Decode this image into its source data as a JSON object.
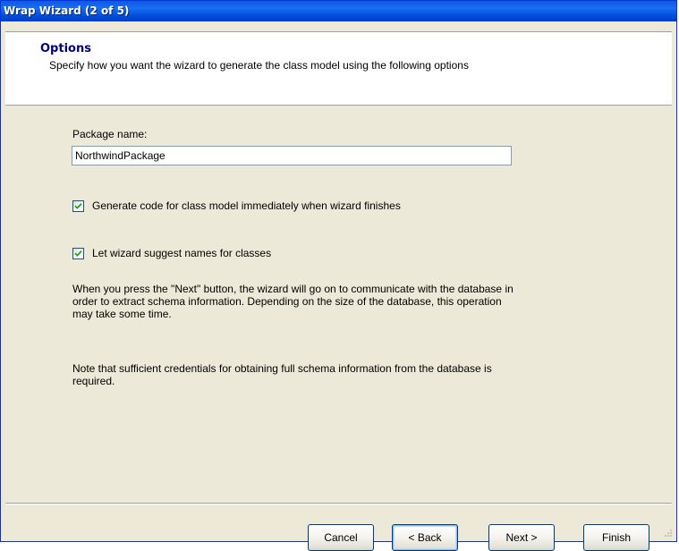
{
  "window": {
    "title": "Wrap Wizard (2 of 5)"
  },
  "header": {
    "title": "Options",
    "subtitle": "Specify how you want the wizard to generate the class model using the following options"
  },
  "form": {
    "package_label": "Package name:",
    "package_value": "NorthwindPackage",
    "generate_code": {
      "label": "Generate code for class model immediately when wizard finishes",
      "checked": true
    },
    "suggest_names": {
      "label": "Let wizard suggest names for classes",
      "checked": true
    },
    "info_text": "When you press the \"Next\" button, the wizard will go on to communicate with the database in order to extract schema information. Depending on the size of the database, this operation may take some time.",
    "note_text": "Note that sufficient credentials for obtaining full schema information from the database is required."
  },
  "buttons": {
    "cancel": "Cancel",
    "back": "< Back",
    "next": "Next >",
    "finish": "Finish"
  },
  "colors": {
    "titlebar": "#0a5ae6",
    "header_title": "#000080",
    "dialog_bg": "#ece9d8",
    "check_mark": "#21a121"
  }
}
